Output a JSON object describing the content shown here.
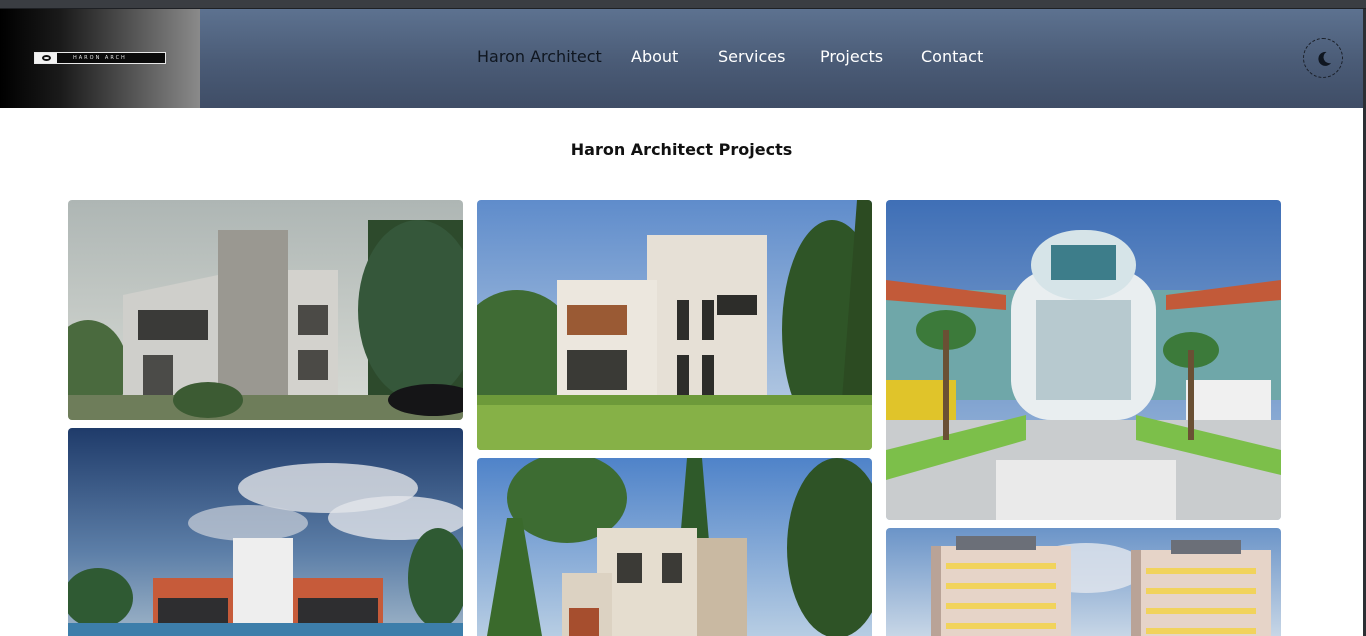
{
  "header": {
    "logo_text": "HARON ARCH",
    "nav": {
      "brand": "Haron Architect",
      "about": "About",
      "services": "Services",
      "projects": "Projects",
      "contact": "Contact"
    },
    "theme_icon": "moon-icon"
  },
  "main": {
    "title": "Haron Architect Projects",
    "projects": [
      {
        "image": "modern-two-storey-house"
      },
      {
        "image": "three-storey-villa-garden"
      },
      {
        "image": "bus-terminal-canopy"
      },
      {
        "image": "resort-pool-building"
      },
      {
        "image": "villa-pine-trees"
      },
      {
        "image": "apartment-towers"
      }
    ]
  },
  "colors": {
    "header_top": "#5d7290",
    "header_bottom": "#3f4d66",
    "brand_text": "#0f1620",
    "nav_text": "#ffffff"
  }
}
